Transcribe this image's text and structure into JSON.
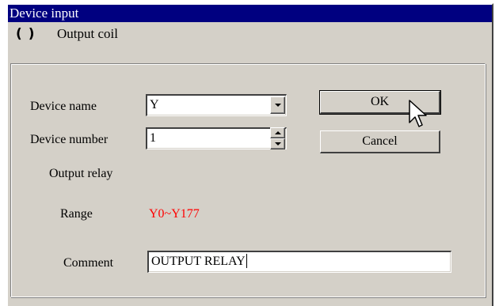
{
  "window": {
    "title": "Device input"
  },
  "instruction": {
    "icon": "coil-bracket-icon",
    "icon_glyph": "( )",
    "label": "Output coil"
  },
  "form": {
    "device_name": {
      "label": "Device name",
      "value": "Y"
    },
    "device_number": {
      "label": "Device number",
      "value": "1"
    },
    "device_type": "Output relay",
    "range": {
      "label": "Range",
      "value": "Y0~Y177",
      "color": "#ff0000"
    },
    "comment": {
      "label": "Comment",
      "value": "OUTPUT RELAY"
    }
  },
  "buttons": {
    "ok": "OK",
    "cancel": "Cancel"
  },
  "colors": {
    "titlebar": "#000080",
    "dialog_face": "#d4d0c8"
  }
}
